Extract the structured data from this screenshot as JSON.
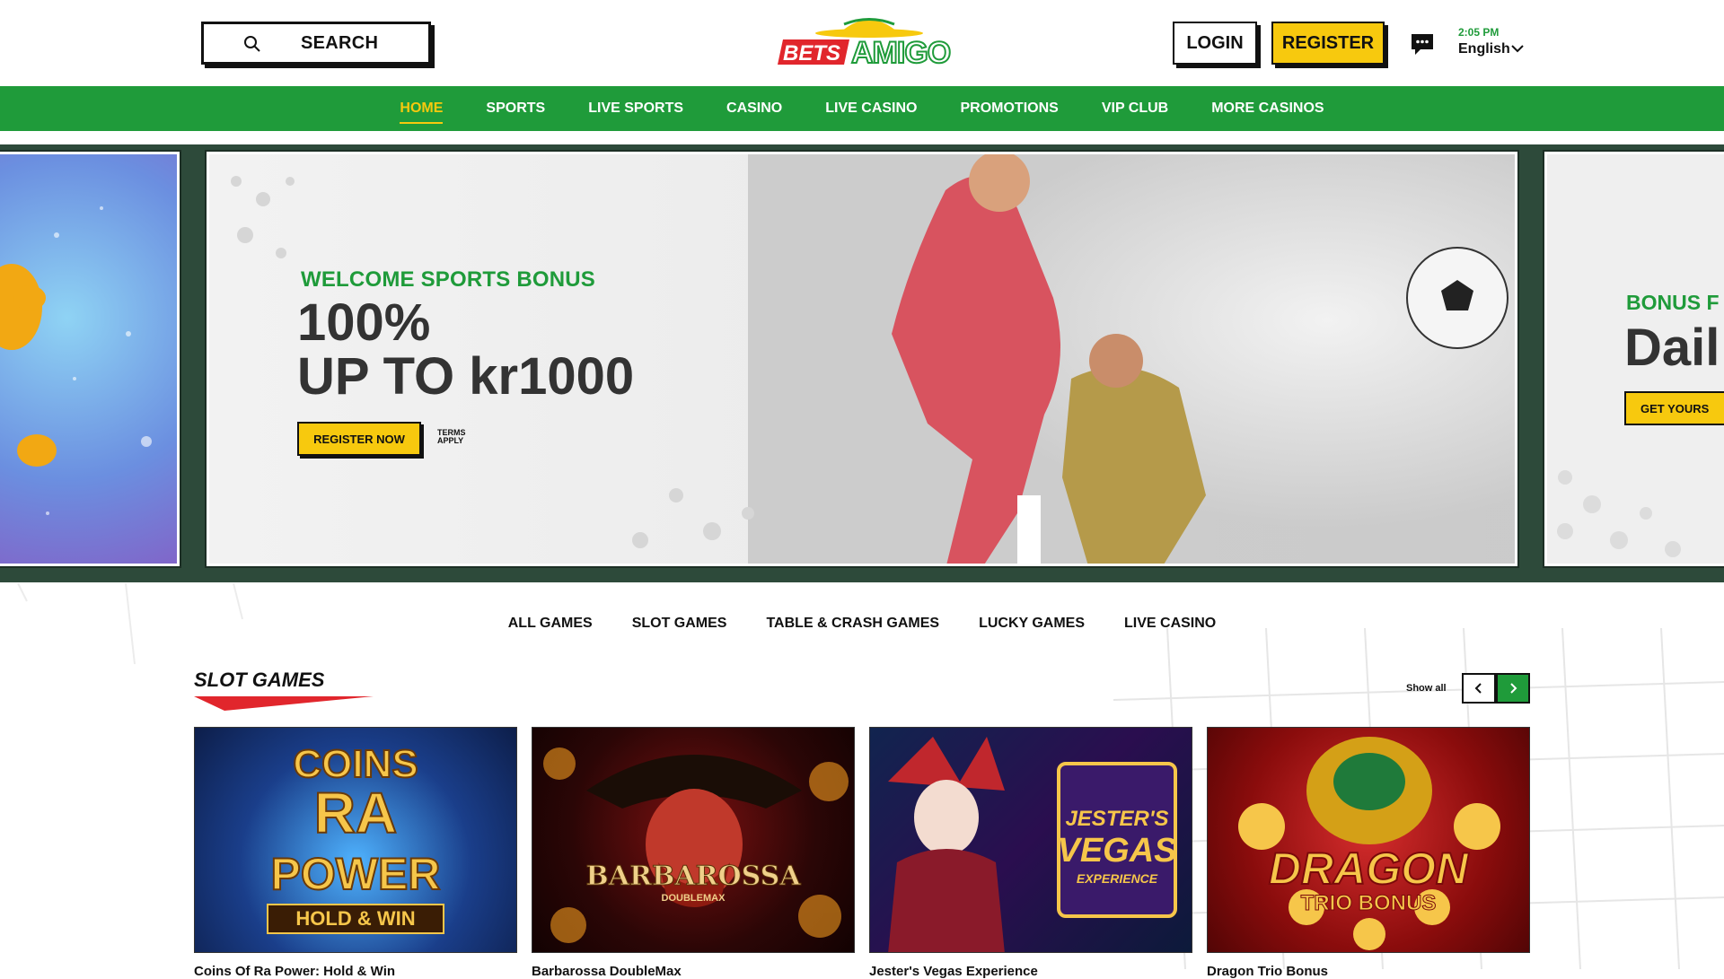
{
  "header": {
    "search_label": "SEARCH",
    "logo_text_left": "BETS",
    "logo_text_right": "AMIGO",
    "login_label": "LOGIN",
    "register_label": "REGISTER",
    "time": "2:05 PM",
    "language": "English"
  },
  "nav": {
    "items": [
      {
        "label": "HOME",
        "active": true
      },
      {
        "label": "SPORTS"
      },
      {
        "label": "LIVE SPORTS"
      },
      {
        "label": "CASINO"
      },
      {
        "label": "LIVE CASINO"
      },
      {
        "label": "PROMOTIONS"
      },
      {
        "label": "VIP CLUB"
      },
      {
        "label": "MORE CASINOS"
      }
    ]
  },
  "carousel": {
    "main": {
      "subtitle": "WELCOME SPORTS BONUS",
      "line1": "100%",
      "line2": "UP TO kr1000",
      "cta": "REGISTER NOW",
      "terms": "TERMS APPLY"
    },
    "right": {
      "subtitle": "BONUS F",
      "title": "Dail",
      "cta": "GET YOURS"
    }
  },
  "games_tabs": [
    "ALL GAMES",
    "SLOT GAMES",
    "TABLE & CRASH GAMES",
    "LUCKY GAMES",
    "LIVE CASINO"
  ],
  "slot_section": {
    "title": "SLOT GAMES",
    "show_all": "Show all",
    "games": [
      {
        "art_line1": "COINS",
        "art_line2": "RA",
        "art_line3": "POWER",
        "art_line4": "HOLD & WIN",
        "title": "Coins Of Ra Power: Hold & Win"
      },
      {
        "art_line1": "BARBAROSSA",
        "art_line2": "DOUBLEMAX",
        "title": "Barbarossa DoubleMax"
      },
      {
        "art_line1": "JESTER'S",
        "art_line2": "VEGAS",
        "art_line3": "EXPERIENCE",
        "title": "Jester's Vegas Experience"
      },
      {
        "art_line1": "DRAGON",
        "art_line2": "TRIO BONUS",
        "title": "Dragon Trio Bonus"
      }
    ]
  },
  "colors": {
    "brand_green": "#1f9b3a",
    "accent_yellow": "#f7c90e",
    "carousel_bg": "#2d4a3a",
    "logo_red": "#e1262c"
  }
}
